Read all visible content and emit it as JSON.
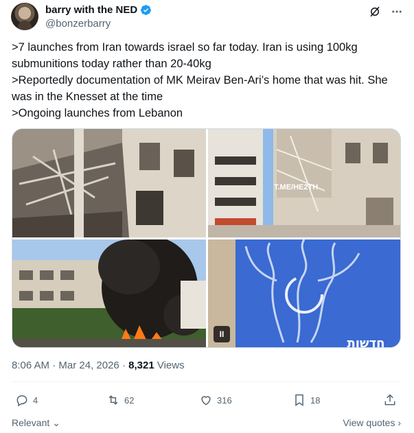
{
  "author": {
    "display_name": "barry with the NED",
    "handle": "@bonzerbarry",
    "verified": true
  },
  "header_icons": [
    "grok-icon",
    "more-icon"
  ],
  "tweet": {
    "lines": [
      ">7 launches from Iran towards israel so far today. Iran is using 100kg submunitions today rather than 20-40kg",
      ">Reportedly documentation of MK Meirav Ben-Ari’s home that was hit. She was in the Knesset at the time",
      ">Ongoing launches from Lebanon"
    ]
  },
  "media": {
    "watermark": "T.ME/HE2TH",
    "video_overlay_text": "חדשות",
    "play_label": "II"
  },
  "meta": {
    "time": "8:06 AM",
    "date": "Mar 24, 2026",
    "views_count": "8,321",
    "views_label": "Views",
    "separator": "·"
  },
  "actions": {
    "replies": "4",
    "reposts": "62",
    "likes": "316",
    "bookmarks": "18"
  },
  "bottom": {
    "sort_label": "Relevant",
    "view_quotes": "View quotes"
  },
  "colors": {
    "text": "#0f1419",
    "muted": "#536471",
    "verified_blue": "#1d9bf0",
    "border": "#cfd9de"
  }
}
